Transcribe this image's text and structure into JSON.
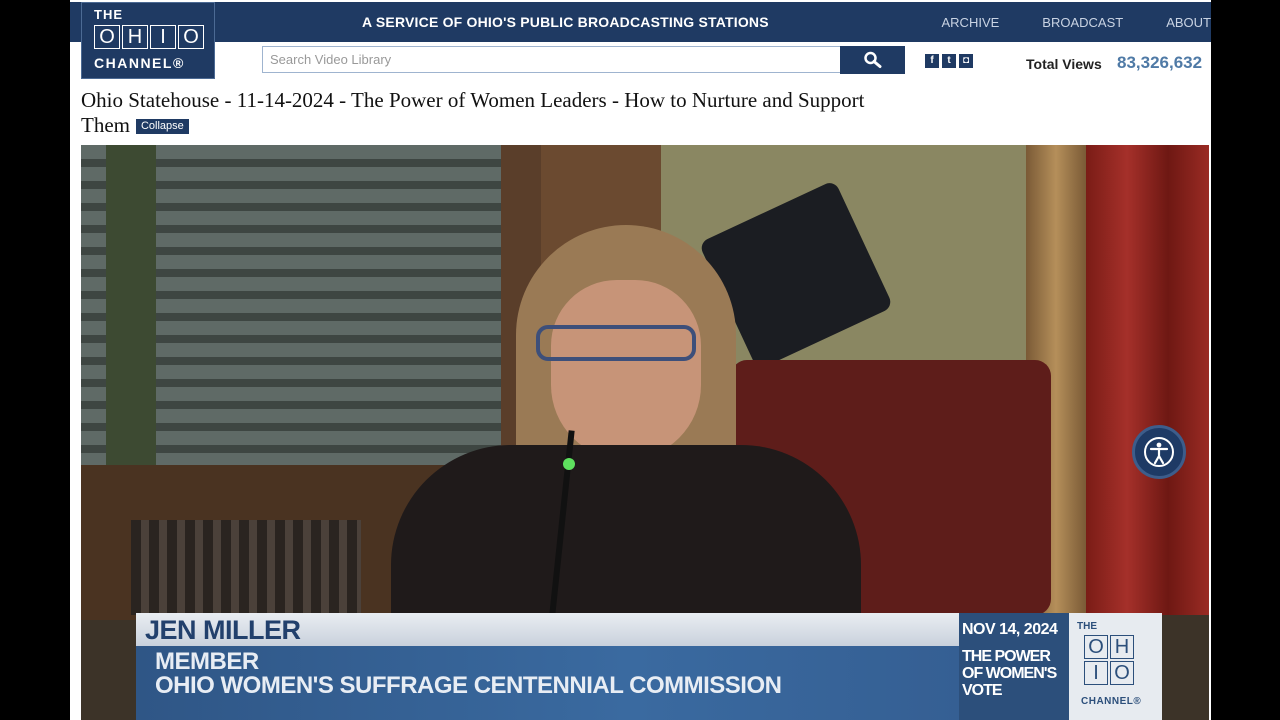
{
  "header": {
    "logo": {
      "the": "THE",
      "ohio_letters": [
        "O",
        "H",
        "I",
        "O"
      ],
      "channel": "CHANNEL®"
    },
    "service_text": "A SERVICE OF OHIO'S PUBLIC BROADCASTING STATIONS",
    "nav": [
      {
        "label": "ARCHIVE"
      },
      {
        "label": "BROADCAST"
      },
      {
        "label": "ABOUT"
      }
    ]
  },
  "search": {
    "placeholder": "Search Video Library",
    "value": ""
  },
  "social": [
    {
      "icon": "facebook-icon",
      "glyph": "f"
    },
    {
      "icon": "twitter-icon",
      "glyph": "t"
    },
    {
      "icon": "instagram-icon",
      "glyph": "◘"
    }
  ],
  "stats": {
    "label": "Total Views",
    "value": "83,326,632"
  },
  "video": {
    "title": "Ohio Statehouse - 11-14-2024 - The Power of Women Leaders - How to Nurture and Support Them",
    "collapse_label": "Collapse",
    "lower_third": {
      "name": "JEN MILLER",
      "role_line1": "MEMBER",
      "role_line2": "OHIO WOMEN'S SUFFRAGE CENTENNIAL COMMISSION",
      "date": "NOV 14, 2024",
      "program": "THE POWER OF WOMEN'S VOTE",
      "logo": {
        "the": "THE",
        "ohio_letters": [
          "O",
          "H",
          "I",
          "O"
        ],
        "channel": "CHANNEL®"
      }
    }
  },
  "colors": {
    "brand_navy": "#1f3a63",
    "views_blue": "#4f7aa6"
  }
}
